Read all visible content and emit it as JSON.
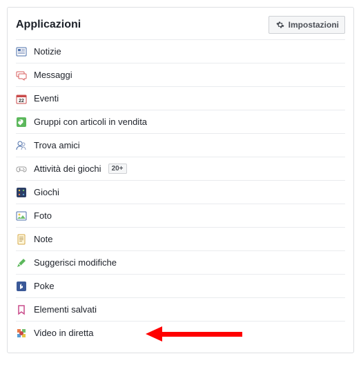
{
  "title": "Applicazioni",
  "settings": {
    "label": "Impostazioni"
  },
  "items": [
    {
      "label": "Notizie",
      "icon": "news"
    },
    {
      "label": "Messaggi",
      "icon": "messages"
    },
    {
      "label": "Eventi",
      "icon": "events"
    },
    {
      "label": "Gruppi con articoli in vendita",
      "icon": "sale-group"
    },
    {
      "label": "Trova amici",
      "icon": "find-friends"
    },
    {
      "label": "Attività dei giochi",
      "icon": "game-activity",
      "badge": "20+"
    },
    {
      "label": "Giochi",
      "icon": "games"
    },
    {
      "label": "Foto",
      "icon": "photos"
    },
    {
      "label": "Note",
      "icon": "notes"
    },
    {
      "label": "Suggerisci modifiche",
      "icon": "suggest-edits"
    },
    {
      "label": "Poke",
      "icon": "poke"
    },
    {
      "label": "Elementi salvati",
      "icon": "saved"
    },
    {
      "label": "Video in diretta",
      "icon": "live-video"
    }
  ]
}
